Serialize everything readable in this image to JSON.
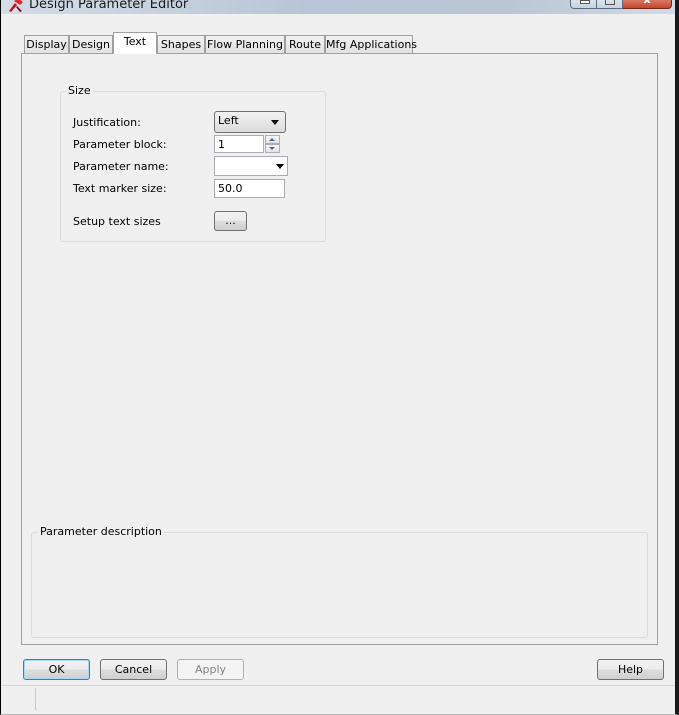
{
  "window": {
    "title": "Design Parameter Editor",
    "close_symbol": "x"
  },
  "tabs": [
    {
      "label": "Display",
      "active": false
    },
    {
      "label": "Design",
      "active": false
    },
    {
      "label": "Text",
      "active": true
    },
    {
      "label": "Shapes",
      "active": false
    },
    {
      "label": "Flow Planning",
      "active": false
    },
    {
      "label": "Route",
      "active": false
    },
    {
      "label": "Mfg Applications",
      "active": false
    }
  ],
  "size_group": {
    "title": "Size",
    "justification_label": "Justification:",
    "justification_value": "Left",
    "parameter_block_label": "Parameter block:",
    "parameter_block_value": "1",
    "parameter_name_label": "Parameter name:",
    "parameter_name_value": "",
    "text_marker_size_label": "Text marker size:",
    "text_marker_size_value": "50.0",
    "setup_text_sizes_label": "Setup text sizes",
    "setup_button_label": "..."
  },
  "description_group": {
    "title": "Parameter description"
  },
  "buttons": {
    "ok": "OK",
    "cancel": "Cancel",
    "apply": "Apply",
    "help": "Help"
  },
  "colors": {
    "dialog_background": "#f0f0f0",
    "default_button_border": "#3c7fb1",
    "close_button": "#c6452c"
  },
  "icons": {
    "app": "red-tool-icon"
  }
}
